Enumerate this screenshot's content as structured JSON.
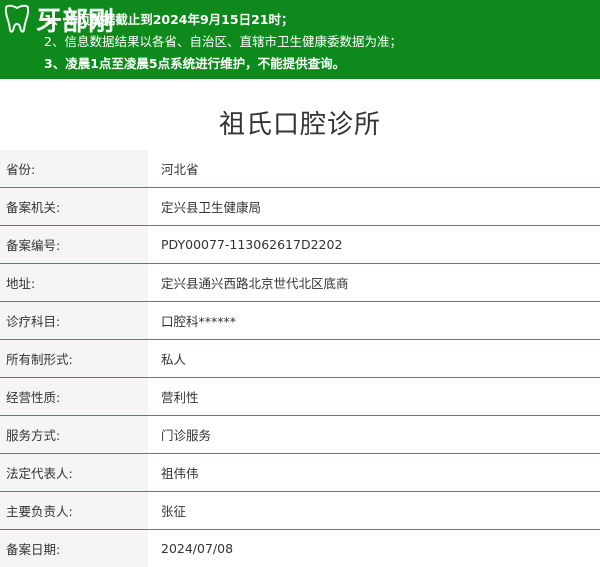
{
  "banner": {
    "logo_text": "牙部刚",
    "lines": [
      "1、本页数据截止到2024年9月15日21时；",
      "2、信息数据结果以各省、自治区、直辖市卫生健康委数据为准；",
      "3、凌晨1点至凌晨5点系统进行维护，不能提供查询。"
    ]
  },
  "title": "祖氏口腔诊所",
  "rows": [
    {
      "label": "省份:",
      "value": "河北省"
    },
    {
      "label": "备案机关:",
      "value": "定兴县卫生健康局"
    },
    {
      "label": "备案编号:",
      "value": "PDY00077-113062617D2202"
    },
    {
      "label": "地址:",
      "value": "定兴县通兴西路北京世代北区底商"
    },
    {
      "label": "诊疗科目:",
      "value": "口腔科******"
    },
    {
      "label": "所有制形式:",
      "value": "私人"
    },
    {
      "label": "经营性质:",
      "value": "营利性"
    },
    {
      "label": "服务方式:",
      "value": "门诊服务"
    },
    {
      "label": "法定代表人:",
      "value": "祖伟伟"
    },
    {
      "label": "主要负责人:",
      "value": "张征"
    },
    {
      "label": "备案日期:",
      "value": "2024/07/08"
    }
  ],
  "colors": {
    "banner_bg": "#0e8a1c",
    "row_border": "#4a8a6a",
    "label_bg": "#f5f5f5"
  }
}
